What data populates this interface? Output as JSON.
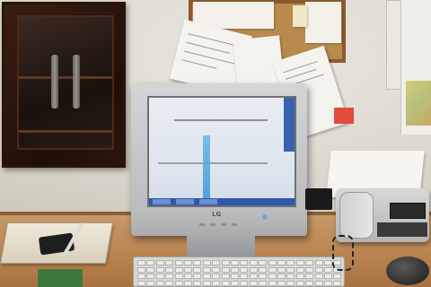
{
  "scene": {
    "objects": [
      "cabinet",
      "corkboard",
      "monitor",
      "keyboard",
      "desk-phone",
      "mouse",
      "mobile-phone",
      "tray"
    ]
  },
  "monitor": {
    "brand": "LG"
  },
  "colors": {
    "wall": "#e6e2d8",
    "desk": "#c89868",
    "cabinet": "#2a140a",
    "monitor_bezel": "#c6c8ca",
    "screen": "#e2e8f0",
    "taskbar": "#2e58a8"
  }
}
